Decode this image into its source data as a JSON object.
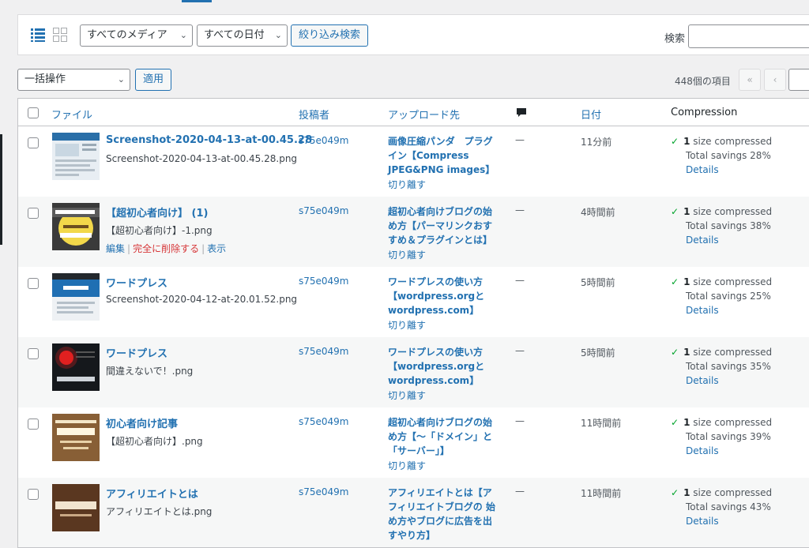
{
  "filters": {
    "media_select": "すべてのメディア",
    "date_select": "すべての日付",
    "filter_button": "絞り込み検索",
    "search_label": "検索",
    "search_value": ""
  },
  "bulk": {
    "select": "一括操作",
    "apply": "適用"
  },
  "pagination": {
    "count": "448個の項目",
    "first": "«",
    "prev": "‹"
  },
  "columns": {
    "file": "ファイル",
    "author": "投稿者",
    "uploaded_to": "アップロード先",
    "comments_icon": "comment-bubble-icon",
    "date": "日付",
    "compression": "Compression"
  },
  "rows": [
    {
      "title": "Screenshot-2020-04-13-at-00.45.28",
      "filename": "Screenshot-2020-04-13-at-00.45.28.png",
      "author": "s75e049m",
      "upload_lines": [
        "画像圧縮パンダ　プラグ",
        "イン【Compress",
        "JPEG&PNG images】"
      ],
      "detach": "切り離す",
      "comments": "—",
      "date": "11分前",
      "comp_count": "1",
      "comp_text": "size compressed",
      "savings": "Total savings 28%",
      "details": "Details"
    },
    {
      "title": "【超初心者向け】 (1)",
      "filename": "【超初心者向け】-1.png",
      "actions": {
        "edit": "編集",
        "delete": "完全に削除する",
        "view": "表示"
      },
      "author": "s75e049m",
      "upload_lines": [
        "超初心者向けブログの始",
        "め方【パーマリンクおす",
        "すめ＆プラグインとは】"
      ],
      "detach": "切り離す",
      "comments": "—",
      "date": "4時間前",
      "comp_count": "1",
      "comp_text": "size compressed",
      "savings": "Total savings 38%",
      "details": "Details"
    },
    {
      "title": "ワードプレス",
      "filename": "Screenshot-2020-04-12-at-20.01.52.png",
      "author": "s75e049m",
      "upload_lines": [
        "ワードプレスの使い方",
        "【wordpress.orgと",
        "wordpress.com】"
      ],
      "detach": "切り離す",
      "comments": "—",
      "date": "5時間前",
      "comp_count": "1",
      "comp_text": "size compressed",
      "savings": "Total savings 25%",
      "details": "Details"
    },
    {
      "title": "ワードプレス",
      "filename": "間違えないで！.png",
      "author": "s75e049m",
      "upload_lines": [
        "ワードプレスの使い方",
        "【wordpress.orgと",
        "wordpress.com】"
      ],
      "detach": "切り離す",
      "comments": "—",
      "date": "5時間前",
      "comp_count": "1",
      "comp_text": "size compressed",
      "savings": "Total savings 35%",
      "details": "Details"
    },
    {
      "title": "初心者向け記事",
      "filename": "【超初心者向け】.png",
      "author": "s75e049m",
      "upload_lines": [
        "超初心者向けブログの始",
        "め方【〜「ドメイン」と",
        "「サーバー」】"
      ],
      "detach": "切り離す",
      "comments": "—",
      "date": "11時間前",
      "comp_count": "1",
      "comp_text": "size compressed",
      "savings": "Total savings 39%",
      "details": "Details"
    },
    {
      "title": "アフィリエイトとは",
      "filename": "アフィリエイトとは.png",
      "author": "s75e049m",
      "upload_lines": [
        "アフィリエイトとは【ア",
        "フィリエイトブログの 始",
        "め方やブログに広告を出",
        "すやり方】"
      ],
      "detach": "",
      "comments": "—",
      "date": "11時間前",
      "comp_count": "1",
      "comp_text": "size compressed",
      "savings": "Total savings 43%",
      "details": "Details"
    }
  ]
}
